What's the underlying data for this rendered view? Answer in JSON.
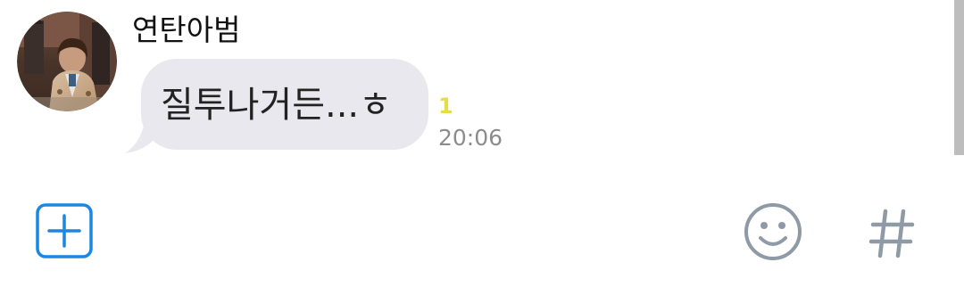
{
  "chat": {
    "message": {
      "sender_name": "연탄아범",
      "text": "질투나거든...ㅎ",
      "unread_count": "1",
      "time": "20:06"
    }
  },
  "input_bar": {
    "left_icon": "add-attachment-icon",
    "right_icons": [
      "emoji-icon",
      "hashtag-icon"
    ]
  },
  "colors": {
    "bubble": "#e8e8ee",
    "unread": "#e6dc48",
    "accent": "#1c87e0",
    "icon_gray": "#8e9aa6",
    "timestamp": "#8c8c8c"
  }
}
